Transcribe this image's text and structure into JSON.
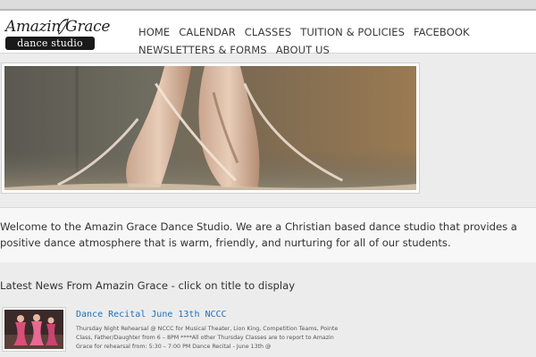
{
  "brand": {
    "script": "Amazin Grace",
    "bar": "dance studio"
  },
  "nav": {
    "row1": [
      "HOME",
      "CALENDAR",
      "CLASSES",
      "TUITION & POLICIES",
      "FACEBOOK"
    ],
    "row2": [
      "NEWSLETTERS & FORMS",
      "ABOUT US"
    ]
  },
  "welcome": {
    "text": "Welcome to the Amazin Grace Dance Studio. We are a Christian based dance studio that provides a positive dance atmosphere that is warm, friendly, and nurturing for all of our students."
  },
  "news": {
    "heading": "Latest News From Amazin Grace - click on title to display",
    "items": [
      {
        "title": "Dance Recital June 13th NCCC",
        "excerpt": "Thursday Night Rehearsal @ NCCC for Musical Theater, Lion King, Competition Teams, Pointe Class, Father/Daughter from 6 – 8PM  ****All other Thursday Classes are to report to Amazin Grace for rehearsal from: 5:30 – 7:00 PM Dance Recital - June 13th @"
      }
    ]
  },
  "colors": {
    "link": "#1e72b8",
    "header_bg": "#ffffff",
    "page_bg": "#ececec"
  }
}
